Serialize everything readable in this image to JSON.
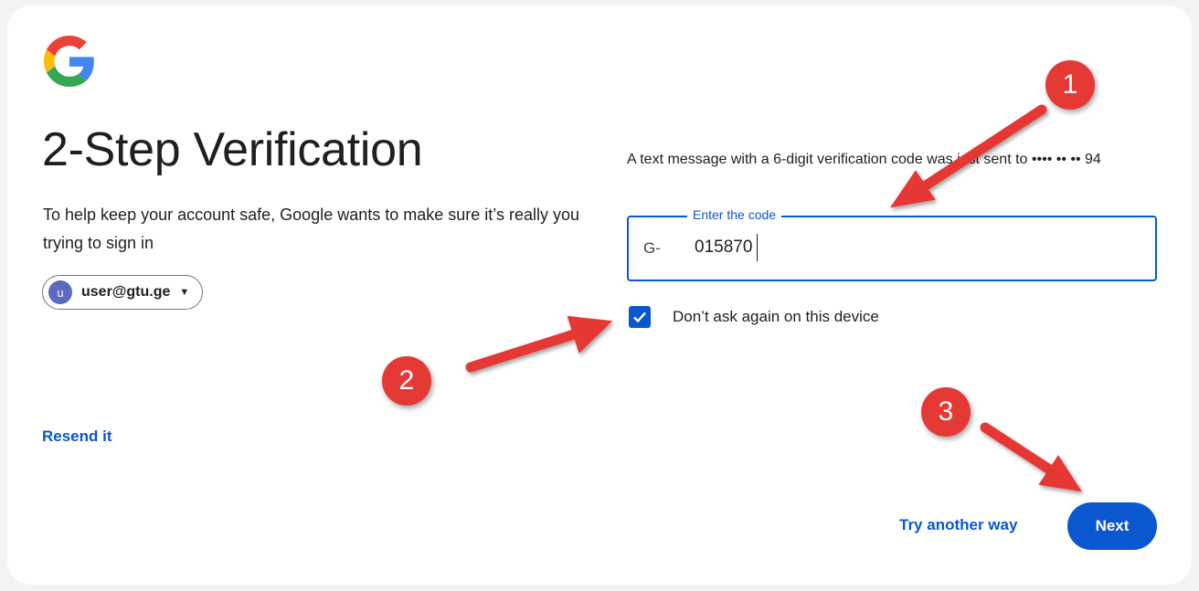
{
  "header": {
    "logo_icon": "google-g-icon",
    "title": "2-Step Verification",
    "subtitle": "To help keep your account safe, Google wants to make sure it’s really you trying to sign in"
  },
  "account": {
    "avatar_letter": "u",
    "email": "user@gtu.ge",
    "dropdown_icon": "caret-down-icon"
  },
  "links": {
    "resend": "Resend it",
    "try_another": "Try another way"
  },
  "verification": {
    "message": "A text message with a 6-digit verification code was just sent to •••• •• •• 94",
    "field_label": "Enter the code",
    "code_prefix": "G-",
    "code_value": "015870"
  },
  "remember": {
    "label": "Don’t ask again on this device",
    "checked": true
  },
  "actions": {
    "next_label": "Next"
  },
  "annotations": {
    "badges": [
      "1",
      "2",
      "3"
    ],
    "color": "#e53935"
  },
  "colors": {
    "primary": "#0b57d0",
    "text": "#1f1f1f",
    "annotation_red": "#e53935"
  }
}
